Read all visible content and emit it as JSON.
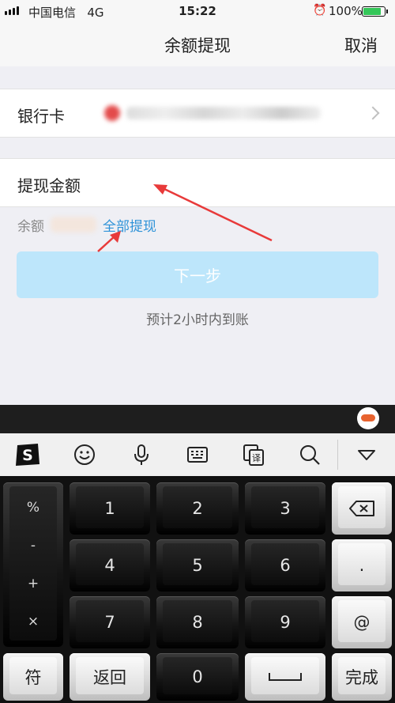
{
  "status": {
    "carrier": "中国电信",
    "network": "4G",
    "time": "15:22",
    "battery": "100%",
    "icons": [
      "signal-icon",
      "alarm-icon",
      "battery-charging-icon"
    ]
  },
  "nav": {
    "title": "余额提现",
    "cancel": "取消"
  },
  "bank_row": {
    "label": "银行卡"
  },
  "amount_row": {
    "label": "提现金额"
  },
  "balance": {
    "label": "余额",
    "withdraw_all": "全部提现"
  },
  "next_button": "下一步",
  "eta": "预计2小时内到账",
  "colors": {
    "link": "#2f93d8",
    "button_disabled": "#bde6fb",
    "background": "#efeff4"
  },
  "keyboard": {
    "toolbar_icons": [
      "sogou-logo-icon",
      "emoji-icon",
      "microphone-icon",
      "keyboard-icon",
      "translate-icon",
      "search-icon",
      "collapse-icon"
    ],
    "symbols": [
      "%",
      "-",
      "+",
      "×"
    ],
    "digits": [
      "1",
      "2",
      "3",
      "4",
      "5",
      "6",
      "7",
      "8",
      "9",
      "0"
    ],
    "dot": ".",
    "at": "@",
    "symbol_key": "符",
    "back_key": "返回",
    "done_key": "完成"
  }
}
